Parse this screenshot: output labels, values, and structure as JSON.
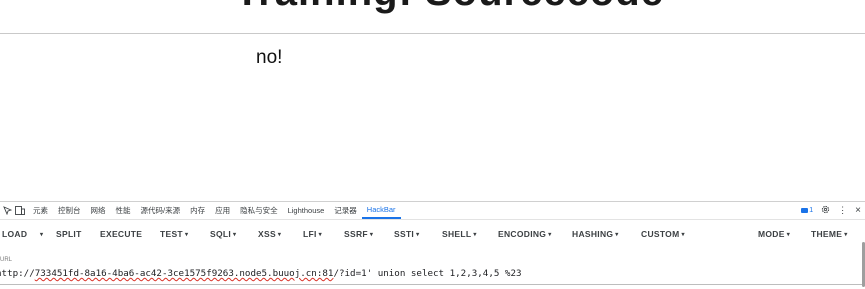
{
  "page": {
    "title": "Training: Sourcecode",
    "message": "no!"
  },
  "devtools": {
    "tabs": [
      {
        "label": "元素"
      },
      {
        "label": "控制台"
      },
      {
        "label": "网络"
      },
      {
        "label": "性能"
      },
      {
        "label": "源代码/来源"
      },
      {
        "label": "内存"
      },
      {
        "label": "应用"
      },
      {
        "label": "隐私与安全"
      },
      {
        "label": "Lighthouse"
      },
      {
        "label": "记录器"
      },
      {
        "label": "HackBar"
      }
    ],
    "active_tab": "HackBar",
    "issues_count": "1",
    "close_glyph": "×",
    "menu_glyph": "⋮"
  },
  "hackbar": {
    "buttons": {
      "load": "LOAD",
      "split": "SPLIT",
      "execute": "EXECUTE",
      "test": "TEST",
      "sqli": "SQLI",
      "xss": "XSS",
      "lfi": "LFI",
      "ssrf": "SSRF",
      "ssti": "SSTI",
      "shell": "SHELL",
      "encoding": "ENCODING",
      "hashing": "HASHING",
      "custom": "CUSTOM",
      "mode": "MODE",
      "theme": "THEME"
    },
    "url_label": "URL",
    "url_prefix": "http://",
    "url_host": "733451fd-8a16-4ba6-ac42-3ce1575f9263.node5.buuoj.cn:81",
    "url_rest": "/?id=1' union select 1,2,3,4,5 %23"
  },
  "colors": {
    "accent": "#1a73e8"
  }
}
